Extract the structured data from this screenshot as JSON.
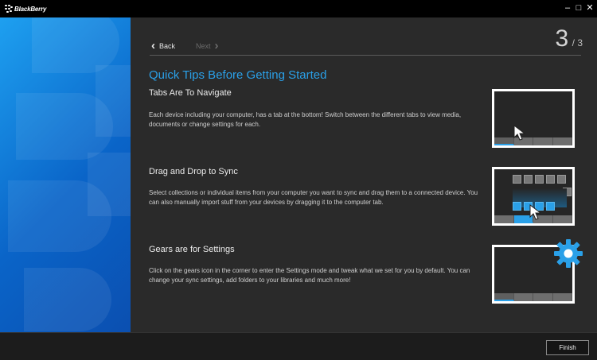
{
  "titlebar": {
    "app_name": "BlackBerry",
    "minimize_glyph": "–",
    "maximize_glyph": "□",
    "close_glyph": "✕"
  },
  "nav": {
    "back_label": "Back",
    "next_label": "Next",
    "back_icon": "chevron-left-icon",
    "next_icon": "chevron-right-icon"
  },
  "pagination": {
    "current": "3",
    "total": "/ 3"
  },
  "heading": "Quick Tips Before Getting Started",
  "sections": [
    {
      "title": "Tabs Are To Navigate",
      "body": "Each device including your computer, has a tab at the bottom! Switch between the different tabs to view media, documents or change settings for each."
    },
    {
      "title": "Drag and Drop to Sync",
      "body": "Select collections or individual items from your computer you want to sync and drag them to a connected device. You can also manually import stuff from your devices by dragging it to the computer tab."
    },
    {
      "title": "Gears are for Settings",
      "body": "Click on the gears icon in the corner to enter the Settings mode and tweak what we set for you by default. You can change your sync settings, add folders to your libraries and much more!"
    }
  ],
  "footer": {
    "finish_label": "Finish"
  },
  "colors": {
    "accent": "#2aa0e8",
    "banner_top": "#1ea0f0",
    "banner_bottom": "#0b4fb0"
  }
}
